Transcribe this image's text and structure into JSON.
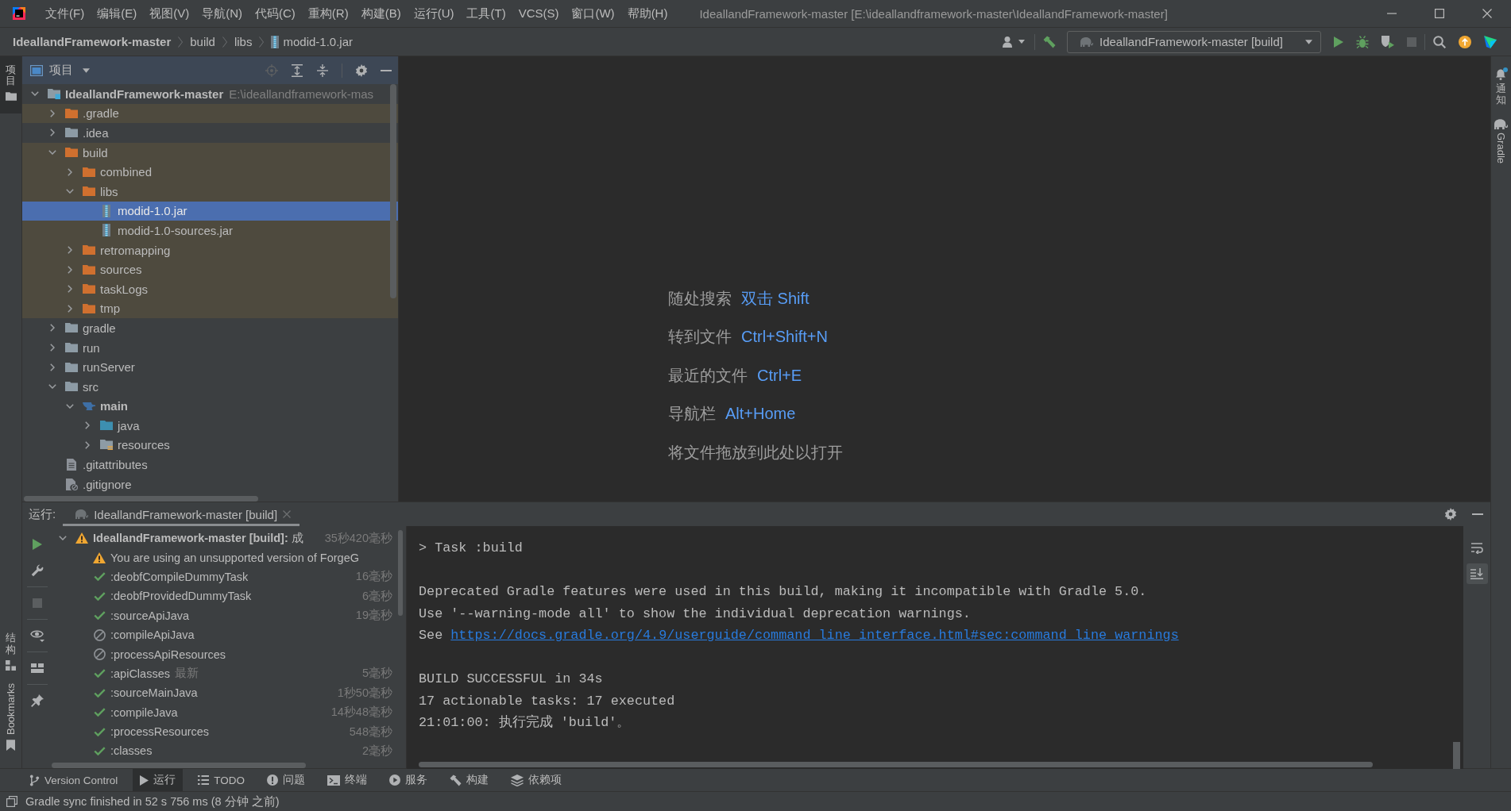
{
  "title_bar": {
    "menu": [
      "文件(F)",
      "编辑(E)",
      "视图(V)",
      "导航(N)",
      "代码(C)",
      "重构(R)",
      "构建(B)",
      "运行(U)",
      "工具(T)",
      "VCS(S)",
      "窗口(W)",
      "帮助(H)"
    ],
    "title": "IdeallandFramework-master [E:\\ideallandframework-master\\IdeallandFramework-master]"
  },
  "nav_bar": {
    "breadcrumbs": [
      {
        "label": "IdeallandFramework-master",
        "kind": "project"
      },
      {
        "label": "build",
        "kind": "folder"
      },
      {
        "label": "libs",
        "kind": "folder"
      },
      {
        "label": "modid-1.0.jar",
        "kind": "jar"
      }
    ],
    "run_config": "IdeallandFramework-master [build]"
  },
  "left_strip": [
    {
      "label": "项目",
      "kind": "project",
      "selected": true
    },
    {
      "label": "结构",
      "kind": "structure",
      "selected": false
    },
    {
      "label": "Bookmarks",
      "kind": "bookmarks",
      "selected": false
    }
  ],
  "project_panel": {
    "title": "项目",
    "tree": [
      {
        "label": "IdeallandFramework-master",
        "path": "E:\\ideallandframework-mas",
        "kind": "project",
        "expanded": true,
        "selected": false,
        "excluded": false,
        "children": [
          {
            "label": ".gradle",
            "kind": "folder",
            "expanded": false,
            "selected": false,
            "excluded": true
          },
          {
            "label": ".idea",
            "kind": "folder",
            "expanded": false,
            "selected": false,
            "excluded": false
          },
          {
            "label": "build",
            "kind": "folder",
            "expanded": true,
            "selected": false,
            "excluded": true,
            "children": [
              {
                "label": "combined",
                "kind": "folder",
                "expanded": false,
                "selected": false,
                "excluded": true
              },
              {
                "label": "libs",
                "kind": "folder",
                "expanded": true,
                "selected": false,
                "excluded": true,
                "children": [
                  {
                    "label": "modid-1.0.jar",
                    "kind": "jar",
                    "selected": true,
                    "excluded": true
                  },
                  {
                    "label": "modid-1.0-sources.jar",
                    "kind": "jar",
                    "selected": false,
                    "excluded": true
                  }
                ]
              },
              {
                "label": "retromapping",
                "kind": "folder",
                "expanded": false,
                "selected": false,
                "excluded": true
              },
              {
                "label": "sources",
                "kind": "folder",
                "expanded": false,
                "selected": false,
                "excluded": true
              },
              {
                "label": "taskLogs",
                "kind": "folder",
                "expanded": false,
                "selected": false,
                "excluded": true
              },
              {
                "label": "tmp",
                "kind": "folder",
                "expanded": false,
                "selected": false,
                "excluded": true
              }
            ]
          },
          {
            "label": "gradle",
            "kind": "folder",
            "expanded": false,
            "selected": false,
            "excluded": false
          },
          {
            "label": "run",
            "kind": "folder",
            "expanded": false,
            "selected": false,
            "excluded": false
          },
          {
            "label": "runServer",
            "kind": "folder",
            "expanded": false,
            "selected": false,
            "excluded": false
          },
          {
            "label": "src",
            "kind": "folder",
            "expanded": true,
            "selected": false,
            "excluded": false,
            "children": [
              {
                "label": "main",
                "kind": "module",
                "expanded": true,
                "selected": false,
                "excluded": false,
                "children": [
                  {
                    "label": "java",
                    "kind": "source",
                    "expanded": false,
                    "selected": false,
                    "excluded": false
                  },
                  {
                    "label": "resources",
                    "kind": "resources",
                    "expanded": false,
                    "selected": false,
                    "excluded": false
                  }
                ]
              }
            ]
          },
          {
            "label": ".gitattributes",
            "kind": "text-file",
            "selected": false,
            "excluded": false
          },
          {
            "label": ".gitignore",
            "kind": "ignore-file",
            "selected": false,
            "excluded": false
          }
        ]
      }
    ]
  },
  "editor": {
    "hints": [
      {
        "label": "随处搜索",
        "shortcut": "双击 Shift"
      },
      {
        "label": "转到文件",
        "shortcut": "Ctrl+Shift+N"
      },
      {
        "label": "最近的文件",
        "shortcut": "Ctrl+E"
      },
      {
        "label": "导航栏",
        "shortcut": "Alt+Home"
      },
      {
        "label": "将文件拖放到此处以打开"
      }
    ]
  },
  "right_strip": [
    {
      "label": "通知",
      "kind": "notifications"
    },
    {
      "label": "Gradle",
      "kind": "gradle"
    }
  ],
  "run_panel": {
    "label": "运行:",
    "tabs": [
      {
        "label": "IdeallandFramework-master [build]",
        "selected": true
      }
    ],
    "tree": [
      {
        "label": "IdeallandFramework-master [build]:",
        "result": "成",
        "time": "35秒420毫秒",
        "kind": "warning",
        "expanded": true,
        "selected": false,
        "children": [
          {
            "label": "You are using an unsupported version of ForgeG",
            "kind": "warning",
            "selected": false
          },
          {
            "label": ":deobfCompileDummyTask",
            "time": "16毫秒",
            "kind": "success",
            "selected": false
          },
          {
            "label": ":deobfProvidedDummyTask",
            "time": "6毫秒",
            "kind": "success",
            "selected": false
          },
          {
            "label": ":sourceApiJava",
            "time": "19毫秒",
            "kind": "success",
            "selected": false
          },
          {
            "label": ":compileApiJava",
            "kind": "skipped",
            "selected": false
          },
          {
            "label": ":processApiResources",
            "kind": "skipped",
            "selected": false
          },
          {
            "label": ":apiClasses",
            "note": "最新",
            "time": "5毫秒",
            "kind": "success",
            "selected": false
          },
          {
            "label": ":sourceMainJava",
            "time": "1秒50毫秒",
            "kind": "success",
            "selected": false
          },
          {
            "label": ":compileJava",
            "time": "14秒48毫秒",
            "kind": "success",
            "selected": false
          },
          {
            "label": ":processResources",
            "time": "548毫秒",
            "kind": "success",
            "selected": false
          },
          {
            "label": ":classes",
            "time": "2毫秒",
            "kind": "success",
            "selected": false
          }
        ]
      }
    ],
    "console": [
      [
        {
          "text": "> Task :build"
        }
      ],
      [
        {
          "text": "Deprecated Gradle features were used in this build, making it incompatible with Gradle 5.0."
        },
        {
          "text": "Use '--warning-mode all' to show the individual deprecation warnings."
        },
        {
          "text": "See",
          "link": "https://docs.gradle.org/4.9/userguide/command_line_interface.html#sec:command_line_warnings"
        }
      ],
      [
        {
          "text": "BUILD SUCCESSFUL in 34s"
        },
        {
          "text": "17 actionable tasks: 17 executed"
        },
        {
          "text": "21:01:00: 执行完成 'build'。"
        }
      ]
    ],
    "console_toolbar": [
      {
        "kind": "soft-wrap",
        "on": false
      },
      {
        "kind": "scroll-to-end",
        "on": true
      }
    ]
  },
  "tool_windows": [
    {
      "label": "Version Control",
      "kind": "vcs",
      "selected": false
    },
    {
      "label": "运行",
      "kind": "run",
      "selected": true
    },
    {
      "label": "TODO",
      "kind": "todo",
      "selected": false
    },
    {
      "label": "问题",
      "kind": "problems",
      "selected": false
    },
    {
      "label": "终端",
      "kind": "terminal",
      "selected": false
    },
    {
      "label": "服务",
      "kind": "services",
      "selected": false
    },
    {
      "label": "构建",
      "kind": "build",
      "selected": false
    },
    {
      "label": "依赖项",
      "kind": "dependencies",
      "selected": false
    }
  ],
  "status_bar": {
    "message": "Gradle sync finished in 52 s 756 ms (8 分钟 之前)"
  }
}
